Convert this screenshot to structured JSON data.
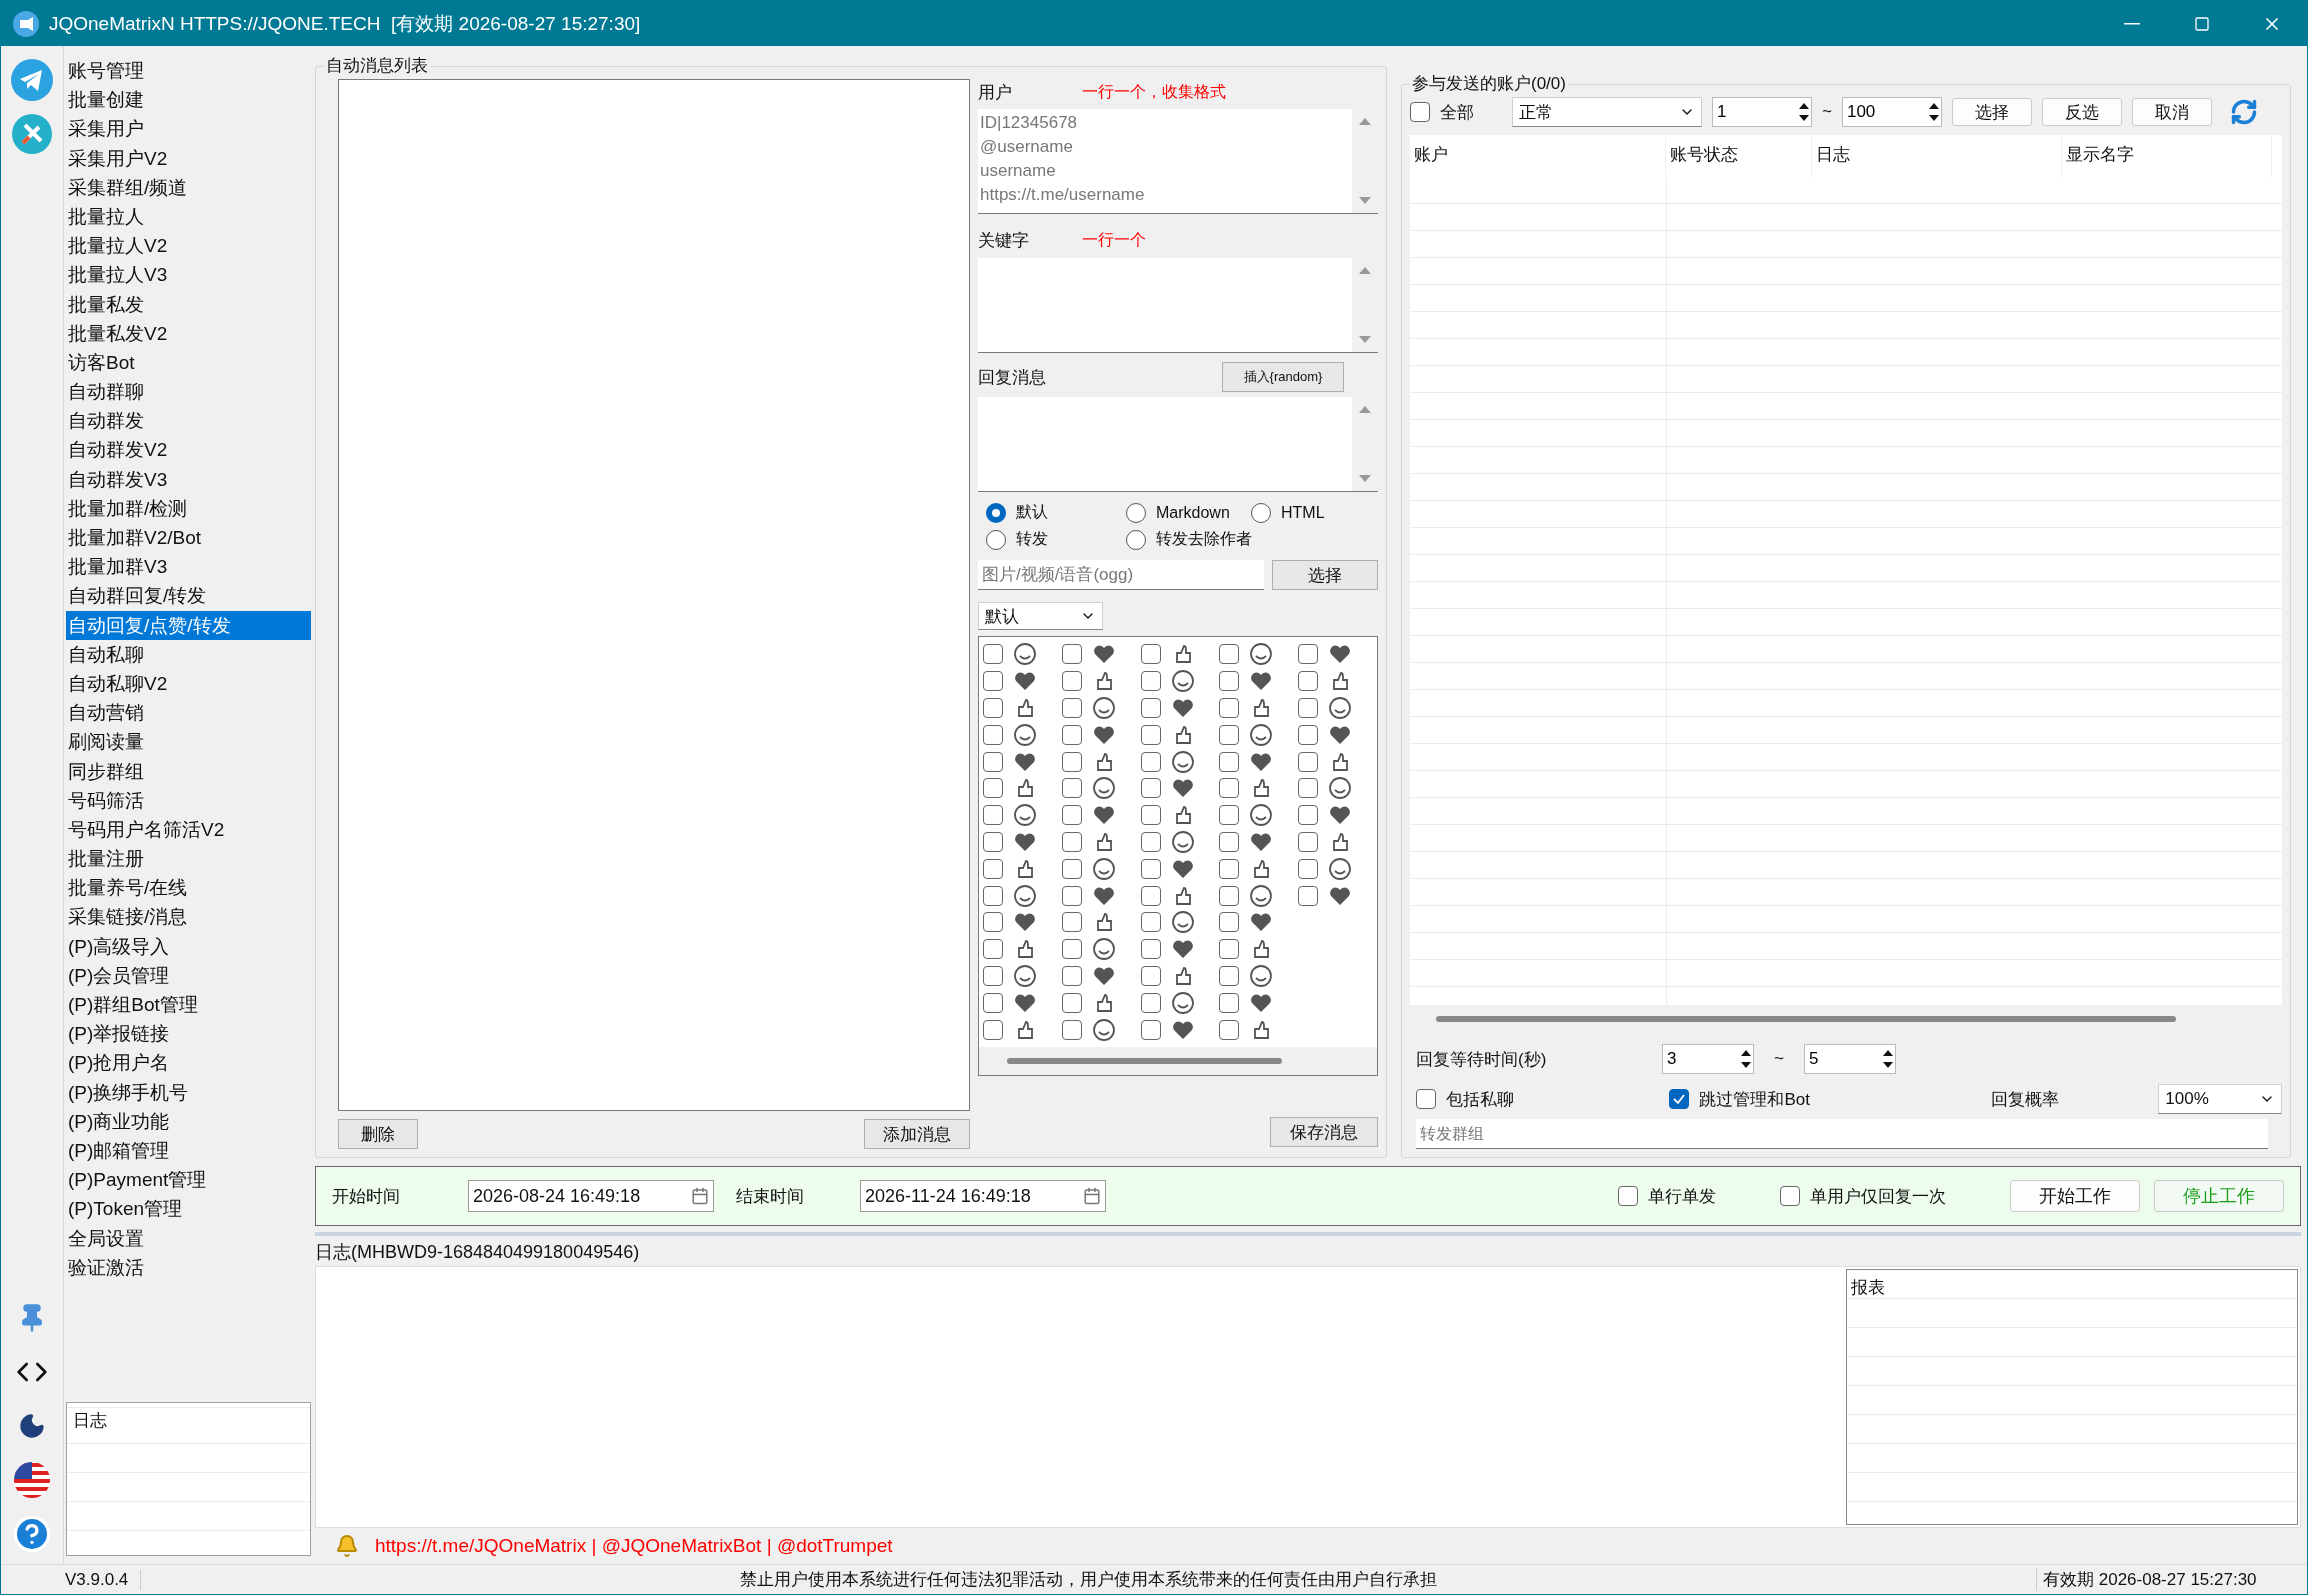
{
  "window": {
    "title": "JQOneMatrixN HTTPS://JQONE.TECH  [有效期 2026-08-27 15:27:30]"
  },
  "sidebar": {
    "items": [
      {
        "label": "账号管理",
        "selected": false
      },
      {
        "label": "批量创建",
        "selected": false
      },
      {
        "label": "采集用户",
        "selected": false
      },
      {
        "label": "采集用户V2",
        "selected": false
      },
      {
        "label": "采集群组/频道",
        "selected": false
      },
      {
        "label": "批量拉人",
        "selected": false
      },
      {
        "label": "批量拉人V2",
        "selected": false
      },
      {
        "label": "批量拉人V3",
        "selected": false
      },
      {
        "label": "批量私发",
        "selected": false
      },
      {
        "label": "批量私发V2",
        "selected": false
      },
      {
        "label": "访客Bot",
        "selected": false
      },
      {
        "label": "自动群聊",
        "selected": false
      },
      {
        "label": "自动群发",
        "selected": false
      },
      {
        "label": "自动群发V2",
        "selected": false
      },
      {
        "label": "自动群发V3",
        "selected": false
      },
      {
        "label": "批量加群/检测",
        "selected": false
      },
      {
        "label": "批量加群V2/Bot",
        "selected": false
      },
      {
        "label": "批量加群V3",
        "selected": false
      },
      {
        "label": "自动群回复/转发",
        "selected": false
      },
      {
        "label": "自动回复/点赞/转发",
        "selected": true
      },
      {
        "label": "自动私聊",
        "selected": false
      },
      {
        "label": "自动私聊V2",
        "selected": false
      },
      {
        "label": "自动营销",
        "selected": false
      },
      {
        "label": "刷阅读量",
        "selected": false
      },
      {
        "label": "同步群组",
        "selected": false
      },
      {
        "label": "号码筛活",
        "selected": false
      },
      {
        "label": "号码用户名筛活V2",
        "selected": false
      },
      {
        "label": "批量注册",
        "selected": false
      },
      {
        "label": "批量养号/在线",
        "selected": false
      },
      {
        "label": "采集链接/消息",
        "selected": false
      },
      {
        "label": "(P)高级导入",
        "selected": false
      },
      {
        "label": "(P)会员管理",
        "selected": false
      },
      {
        "label": "(P)群组Bot管理",
        "selected": false
      },
      {
        "label": "(P)举报链接",
        "selected": false
      },
      {
        "label": "(P)抢用户名",
        "selected": false
      },
      {
        "label": "(P)换绑手机号",
        "selected": false
      },
      {
        "label": "(P)商业功能",
        "selected": false
      },
      {
        "label": "(P)邮箱管理",
        "selected": false
      },
      {
        "label": "(P)Payment管理",
        "selected": false
      },
      {
        "label": "(P)Token管理",
        "selected": false
      },
      {
        "label": "全局设置",
        "selected": false
      },
      {
        "label": "验证激活",
        "selected": false
      }
    ],
    "log": {
      "title": "日志"
    }
  },
  "message_list": {
    "title": "自动消息列表",
    "buttons": [
      "删除",
      "添加消息"
    ]
  },
  "editor": {
    "users": {
      "label": "用户",
      "hint": "一行一个，收集格式",
      "placeholder": "ID|12345678\n@username\nusername\nhttps://t.me/username"
    },
    "keywords": {
      "label": "关键字",
      "hint": "一行一个"
    },
    "reply": {
      "label": "回复消息",
      "insert_button": "插入{random}"
    },
    "formats": [
      {
        "label": "默认",
        "selected": true
      },
      {
        "label": "Markdown",
        "selected": false
      },
      {
        "label": "HTML",
        "selected": false
      },
      {
        "label": "转发",
        "selected": false
      },
      {
        "label": "转发去除作者",
        "selected": false
      }
    ],
    "media": {
      "placeholder": "图片/视频/语音(ogg)",
      "button": "选择"
    },
    "emoji_set": "默认",
    "emoji_columns": [
      {
        "items": [
          {
            "checked": false
          },
          {
            "checked": false
          },
          {
            "checked": false
          },
          {
            "checked": false
          },
          {
            "checked": false
          },
          {
            "checked": false
          },
          {
            "checked": false
          },
          {
            "checked": false
          },
          {
            "checked": false
          },
          {
            "checked": false
          },
          {
            "checked": false
          },
          {
            "checked": false
          },
          {
            "checked": false
          },
          {
            "checked": false
          },
          {
            "checked": false
          }
        ]
      },
      {
        "items": [
          {
            "checked": false
          },
          {
            "checked": false
          },
          {
            "checked": false
          },
          {
            "checked": false
          },
          {
            "checked": false
          },
          {
            "checked": false
          },
          {
            "checked": false
          },
          {
            "checked": false
          },
          {
            "checked": false
          },
          {
            "checked": false
          },
          {
            "checked": false
          },
          {
            "checked": false
          },
          {
            "checked": false
          },
          {
            "checked": false
          },
          {
            "checked": false
          }
        ]
      },
      {
        "items": [
          {
            "checked": false
          },
          {
            "checked": false
          },
          {
            "checked": false
          },
          {
            "checked": false
          },
          {
            "checked": false
          },
          {
            "checked": false
          },
          {
            "checked": false
          },
          {
            "checked": false
          },
          {
            "checked": false
          },
          {
            "checked": false
          },
          {
            "checked": false
          },
          {
            "checked": false
          },
          {
            "checked": false
          },
          {
            "checked": false
          },
          {
            "checked": false
          }
        ]
      },
      {
        "items": [
          {
            "checked": false
          },
          {
            "checked": false
          },
          {
            "checked": false
          },
          {
            "checked": false
          },
          {
            "checked": false
          },
          {
            "checked": false
          },
          {
            "checked": false
          },
          {
            "checked": false
          },
          {
            "checked": false
          },
          {
            "checked": false
          },
          {
            "checked": false
          },
          {
            "checked": false
          },
          {
            "checked": false
          },
          {
            "checked": false
          },
          {
            "checked": false
          }
        ]
      },
      {
        "items": [
          {
            "checked": false
          },
          {
            "checked": false
          },
          {
            "checked": false
          },
          {
            "checked": false
          },
          {
            "checked": false
          },
          {
            "checked": false
          },
          {
            "checked": false
          },
          {
            "checked": false
          },
          {
            "checked": false
          },
          {
            "checked": false
          }
        ]
      }
    ],
    "save_button": "保存消息"
  },
  "accounts": {
    "title": "参与发送的账户(0/0)",
    "all": {
      "label": "全部",
      "checked": false
    },
    "status_filter": "正常",
    "range_from": "1",
    "range_sep": "~",
    "range_to": "100",
    "buttons": [
      "选择",
      "反选",
      "取消"
    ],
    "columns": [
      "账户",
      "账号状态",
      "日志",
      "显示名字"
    ],
    "wait": {
      "label": "回复等待时间(秒)",
      "from": "3",
      "sep": "~",
      "to": "5"
    },
    "options": [
      {
        "label": "包括私聊",
        "checked": false
      },
      {
        "label": "跳过管理和Bot",
        "checked": true
      }
    ],
    "probability": {
      "label": "回复概率",
      "value": "100%"
    },
    "forward": {
      "placeholder": "转发群组"
    }
  },
  "work_bar": {
    "start_label": "开始时间",
    "start": "2026-08-24 16:49:18",
    "end_label": "结束时间",
    "end": "2026-11-24 16:49:18",
    "options": [
      {
        "label": "单行单发",
        "checked": false
      },
      {
        "label": "单用户仅回复一次",
        "checked": false
      }
    ],
    "buttons": [
      {
        "label": "开始工作",
        "kind": "start"
      },
      {
        "label": "停止工作",
        "kind": "stop"
      }
    ]
  },
  "log": {
    "title": "日志(MHBWD9-1684840499180049546)",
    "report_title": "报表"
  },
  "links": "https://t.me/JQOneMatrix | @JQOneMatrixBot | @dotTrumpet",
  "status_bar": {
    "version": "V3.9.0.4",
    "notice": "禁止用户使用本系统进行任何违法犯罪活动，用户使用本系统带来的任何责任由用户自行承担",
    "expiry": "有效期 2026-08-27 15:27:30"
  }
}
